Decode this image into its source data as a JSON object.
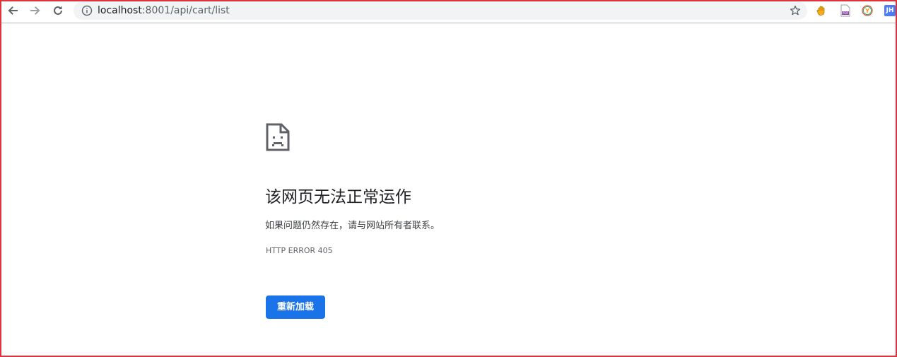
{
  "browser": {
    "url_host": "localhost",
    "url_rest": ":8001/api/cart/list",
    "back_icon": "arrow-left-icon",
    "forward_icon": "arrow-right-icon",
    "reload_icon": "reload-icon",
    "info_icon": "info-icon",
    "bookmark_icon": "star-icon",
    "extensions": [
      {
        "name": "hand-extension-icon"
      },
      {
        "name": "pdf-extension-icon",
        "label": "PDF"
      },
      {
        "name": "y-extension-icon",
        "label": "Y"
      },
      {
        "name": "jh-extension-icon",
        "label": "JH"
      }
    ]
  },
  "error": {
    "icon": "sad-document-icon",
    "title": "该网页无法正常运作",
    "description": "如果问题仍然存在，请与网站所有者联系。",
    "code": "HTTP ERROR 405",
    "reload_label": "重新加载"
  },
  "colors": {
    "accent": "#1a73e8",
    "frame": "#e0313c",
    "omnibox_bg": "#f1f3f4"
  }
}
